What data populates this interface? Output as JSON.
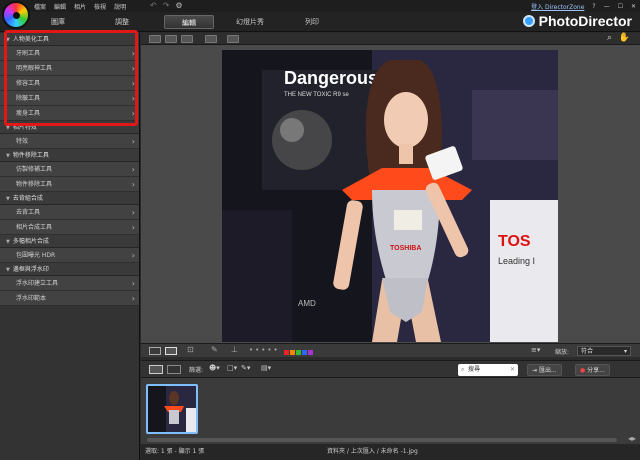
{
  "menu": [
    "檔案",
    "編輯",
    "相片",
    "檢視",
    "說明"
  ],
  "system": {
    "signin": "登入 DirectorZone",
    "help": "?",
    "min": "—",
    "max": "☐",
    "close": "✕"
  },
  "modes": [
    "圖庫",
    "調整",
    "編輯",
    "幻燈片秀",
    "列印"
  ],
  "active_mode": "編輯",
  "brand": "PhotoDirector",
  "sidebar": {
    "sections": [
      {
        "title": "人物美化工具",
        "items": [
          "牙刷工具",
          "明亮眼神工具",
          "修容工具",
          "除皺工具",
          "瘦身工具"
        ]
      },
      {
        "title": "相片特效",
        "items": [
          "特效"
        ]
      },
      {
        "title": "物件移除工具",
        "items": [
          "仿製修補工具",
          "物件移除工具"
        ]
      },
      {
        "title": "去背組合成",
        "items": [
          "去背工具",
          "相片合成工具"
        ]
      },
      {
        "title": "多幅相片合成",
        "items": [
          "包圍曝光 HDR"
        ]
      },
      {
        "title": "邊框與浮水印",
        "items": [
          "浮水印建立工具",
          "浮水印範本"
        ]
      }
    ]
  },
  "photo": {
    "sign_text": "Dangerous",
    "sign_sub": "THE NEW TOXIC R9 se",
    "right_text": "TOS",
    "right_sub": "Leading I",
    "shirt_text": "TOSHIBA",
    "amd": "AMD"
  },
  "viewer_bottom": {
    "zoom_label": "縮放:",
    "zoom_value": "符合"
  },
  "filmbar": {
    "select_label": "篩選:",
    "search_placeholder": "搜尋",
    "export_label": "匯出...",
    "share_label": "分享..."
  },
  "status": {
    "left": "選取: 1 張 - 顯示 1 張",
    "center": "資料夾 / 上次匯入 / 未命名 -1.jpg"
  },
  "colors": {
    "highlight_box": "#e01818",
    "check": "#3aa82e",
    "accent": "#3aa0ff"
  }
}
